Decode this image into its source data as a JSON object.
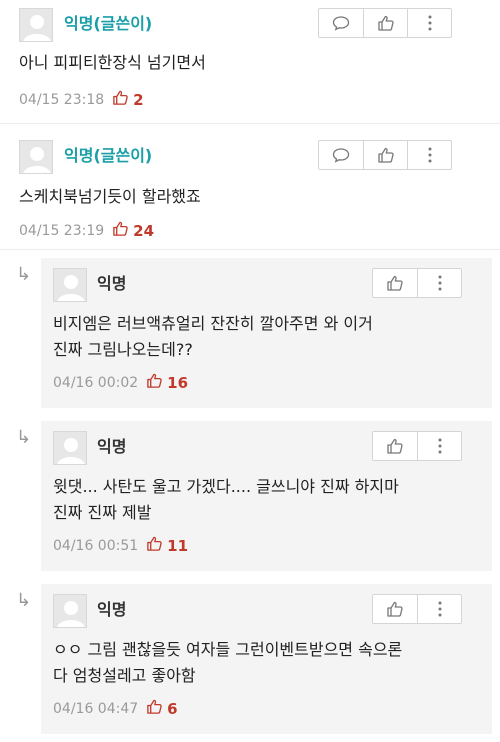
{
  "comments": [
    {
      "author": "익명(글쓴이)",
      "text": "아니 피피티한장식 넘기면서",
      "time": "04/15 23:18",
      "likes": "2"
    },
    {
      "author": "익명(글쓴이)",
      "text": "스케치북넘기듯이 할라했죠",
      "time": "04/15 23:19",
      "likes": "24"
    }
  ],
  "replies": [
    {
      "author": "익명",
      "line1": "비지엠은 러브액츄얼리 잔잔히 깔아주면 와 이거",
      "line2": "진짜 그림나오는데??",
      "time": "04/16 00:02",
      "likes": "16"
    },
    {
      "author": "익명",
      "line1": "윗댓... 사탄도 울고 가겠다.... 글쓰니야 진짜 하지마",
      "line2": "진짜 진짜 제발",
      "time": "04/16 00:51",
      "likes": "11"
    },
    {
      "author": "익명",
      "line1": "ㅇㅇ 그림 괜찮을듯 여자들 그런이벤트받으면 속으론",
      "line2": "다 엄청설레고 좋아함",
      "time": "04/16 04:47",
      "likes": "6"
    }
  ],
  "icons": {
    "reply_arrow": "↳",
    "comment": "speech-bubble-icon",
    "like": "thumbs-up-icon",
    "more": "vertical-dots-icon"
  },
  "colors": {
    "op_author": "#1a9fa8",
    "likes": "#c0392b"
  }
}
